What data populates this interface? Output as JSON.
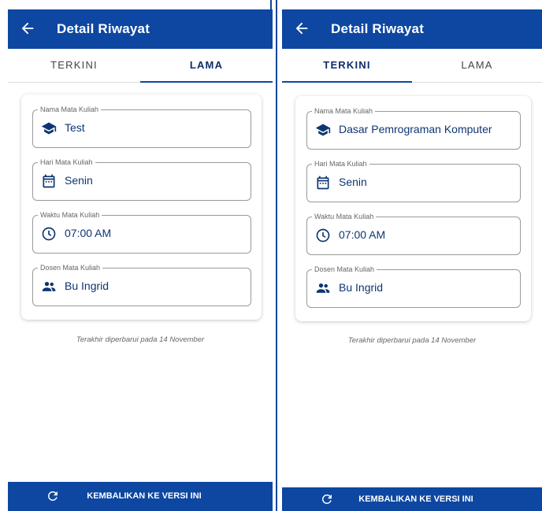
{
  "colors": {
    "primary": "#0d47a1",
    "value_text": "#0d3573"
  },
  "screens": {
    "left": {
      "title": "Detail Riwayat",
      "tabs": [
        "TERKINI",
        "LAMA"
      ],
      "active_tab": "LAMA",
      "fields": [
        {
          "label": "Nama Mata Kuliah",
          "value": "Test",
          "icon": "school-icon"
        },
        {
          "label": "Hari Mata Kuliah",
          "value": "Senin",
          "icon": "calendar-icon"
        },
        {
          "label": "Waktu Mata Kuliah",
          "value": "07:00 AM",
          "icon": "clock-icon"
        },
        {
          "label": "Dosen Mata Kuliah",
          "value": "Bu Ingrid",
          "icon": "people-icon"
        }
      ],
      "updated_text": "Terakhir diperbarui pada 14 November",
      "restore_label": "KEMBALIKAN KE VERSI INI"
    },
    "right": {
      "title": "Detail Riwayat",
      "tabs": [
        "TERKINI",
        "LAMA"
      ],
      "active_tab": "TERKINI",
      "fields": [
        {
          "label": "Nama Mata Kuliah",
          "value": "Dasar Pemrograman Komputer",
          "icon": "school-icon"
        },
        {
          "label": "Hari Mata Kuliah",
          "value": "Senin",
          "icon": "calendar-icon"
        },
        {
          "label": "Waktu Mata Kuliah",
          "value": "07:00 AM",
          "icon": "clock-icon"
        },
        {
          "label": "Dosen Mata Kuliah",
          "value": "Bu Ingrid",
          "icon": "people-icon"
        }
      ],
      "updated_text": "Terakhir diperbarui pada 14 November",
      "restore_label": "KEMBALIKAN KE VERSI INI"
    }
  }
}
